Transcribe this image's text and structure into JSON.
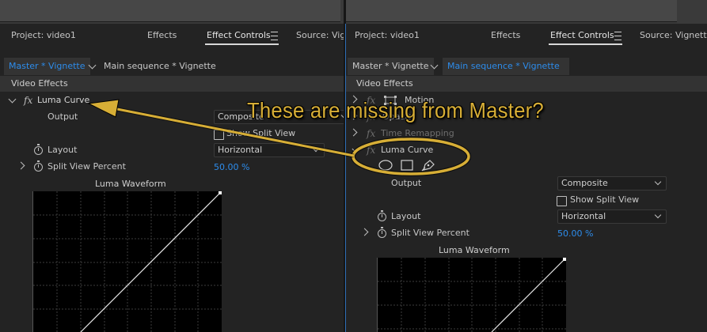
{
  "left_panel": {
    "tabs": [
      {
        "label": "Project: video1"
      },
      {
        "label": "Effects"
      },
      {
        "label": "Effect Controls"
      },
      {
        "label": "Source: Vignette"
      }
    ],
    "sequence": {
      "master": "Master * Vignette",
      "main": "Main sequence * Vignette"
    },
    "section_header": "Video Effects",
    "effect_name": "Luma Curve",
    "output_label": "Output",
    "output_value": "Composite",
    "show_split_view": "Show Split View",
    "layout_label": "Layout",
    "layout_value": "Horizontal",
    "split_view_label": "Split View Percent",
    "split_view_value": "50.00 %",
    "waveform_label": "Luma Waveform"
  },
  "right_panel": {
    "tabs": [
      {
        "label": "Project: video1"
      },
      {
        "label": "Effects"
      },
      {
        "label": "Effect Controls"
      },
      {
        "label": "Source: Vignette"
      }
    ],
    "sequence": {
      "master": "Master * Vignette",
      "main": "Main sequence * Vignette"
    },
    "section_header": "Video Effects",
    "motion_label": "Motion",
    "opacity_label": "Opacity",
    "time_remapping_label": "Time Remapping",
    "effect_name": "Luma Curve",
    "output_label": "Output",
    "output_value": "Composite",
    "show_split_view": "Show Split View",
    "layout_label": "Layout",
    "layout_value": "Horizontal",
    "split_view_label": "Split View Percent",
    "split_view_value": "50.00 %",
    "waveform_label": "Luma Waveform"
  },
  "annotation": {
    "text": "These are missing from Master?",
    "color": "#d7ae36"
  },
  "colors": {
    "accent_blue": "#2d8ceb",
    "panel_bg": "#232323"
  }
}
